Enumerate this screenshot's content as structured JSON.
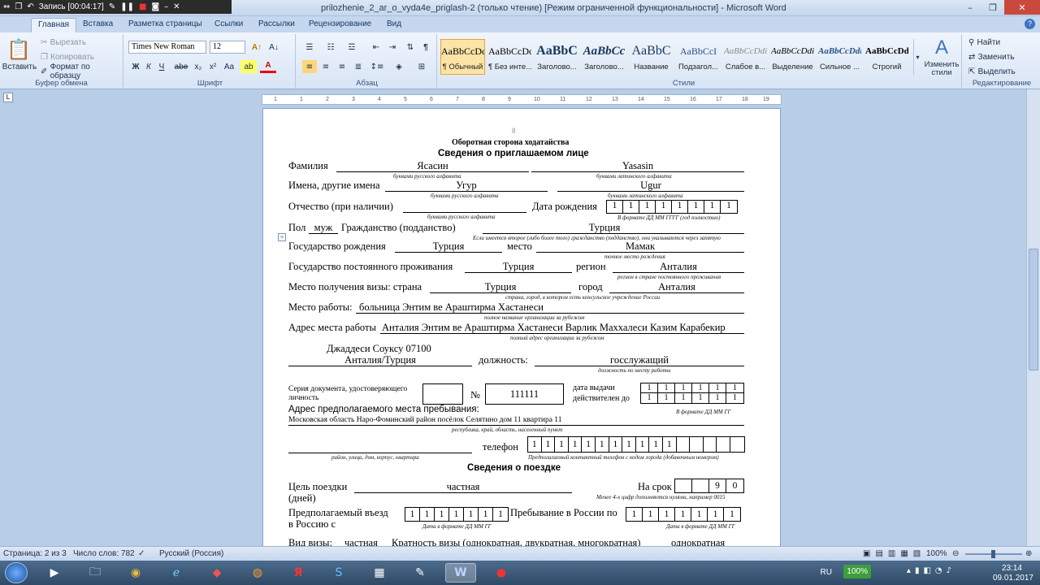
{
  "recorder": {
    "label": "Запись [00:04:17]"
  },
  "window": {
    "title": "prilozhenie_2_ar_o_vyda4e_priglash-2 (только чтение) [Режим ограниченной функциональности] - Microsoft Word"
  },
  "tabs": [
    "Главная",
    "Вставка",
    "Разметка страницы",
    "Ссылки",
    "Рассылки",
    "Рецензирование",
    "Вид"
  ],
  "ribbon": {
    "clipboard": {
      "paste": "Вставить",
      "cut": "Вырезать",
      "copy": "Копировать",
      "format_painter": "Формат по образцу",
      "group": "Буфер обмена"
    },
    "font": {
      "name": "Times New Roman",
      "size": "12",
      "group": "Шрифт"
    },
    "paragraph": {
      "group": "Абзац"
    },
    "styles": {
      "group": "Стили",
      "items": [
        {
          "preview": "AaBbCcDc",
          "name": "¶ Обычный"
        },
        {
          "preview": "AaBbCcDc",
          "name": "¶ Без инте..."
        },
        {
          "preview": "AaBbC",
          "name": "Заголово..."
        },
        {
          "preview": "AaBbCc",
          "name": "Заголово..."
        },
        {
          "preview": "AaBbC",
          "name": "Название"
        },
        {
          "preview": "AaBbCcI",
          "name": "Подзагол..."
        },
        {
          "preview": "AaBbCcDdi",
          "name": "Слабое в..."
        },
        {
          "preview": "AaBbCcDdi",
          "name": "Выделение"
        },
        {
          "preview": "AaBbCcDdi",
          "name": "Сильное ..."
        },
        {
          "preview": "AaBbCcDdE",
          "name": "Строгий"
        }
      ],
      "change": "Изменить стили"
    },
    "editing": {
      "find": "Найти",
      "replace": "Заменить",
      "select": "Выделить",
      "group": "Редактирование"
    }
  },
  "doc": {
    "page_num": "8",
    "title1": "Оборотная сторона ходатайства",
    "title2": "Сведения о приглашаемом лице",
    "surname_label": "Фамилия",
    "surname_ru": "Ясасин",
    "surname_lat": "Yasasin",
    "hint_ru": "буквами русского алфавита",
    "hint_lat": "буквами латинского алфавита",
    "names_label": "Имена, другие имена",
    "names_ru": "Угур",
    "names_lat": "Ugur",
    "patronymic_label": "Отчество (при наличии)",
    "dob_label": "Дата рождения",
    "dob_digits": [
      "1",
      "1",
      "1",
      "1",
      "1",
      "1",
      "1",
      "1"
    ],
    "dob_hint": "В формате ДД ММ ГГГГ (год полностью)",
    "sex_label": "Пол",
    "sex_value": "муж",
    "citizenship_label": "Гражданство (подданство)",
    "citizenship_value": "Турция",
    "citizenship_hint": "Если имеется второе (либо более того) гражданство (подданство), они указываются через запятую",
    "birth_country_label": "Государство рождения",
    "birth_country_value": "Турция",
    "birth_place_label": "место",
    "birth_place_value": "Мамак",
    "birth_place_hint": "точное место рождения",
    "residence_label": "Государство постоянного проживания",
    "residence_value": "Турция",
    "region_label": "регион",
    "region_value": "Анталия",
    "region_hint": "регион в стране постоянного проживания",
    "visa_place_label": "Место получения визы: страна",
    "visa_country": "Турция",
    "city_label": "город",
    "visa_city": "Анталия",
    "visa_hint": "страна, город, в котором есть консульское учреждение России",
    "work_label": "Место работы:",
    "work_value": "больница Энтим ве Араштирма Хастанеси",
    "work_hint": "полное название организации за рубежом",
    "work_addr_label": "Адрес места работы",
    "work_addr_value": "Анталия Энтим ве Араштирма Хастанеси Варлик Маххалеси Казим Карабекир",
    "work_addr_hint": "полный адрес организации за рубежом",
    "work_addr_line2": "Джаддеси Соуксу 07100",
    "work_addr_line3": "Анталия/Турция",
    "position_label": "должность:",
    "position_value": "госслужащий",
    "position_hint": "должность по месту работы",
    "id_doc_label1": "Серия документа, удостоверяющего",
    "id_doc_label2": "личность",
    "no_sign": "№",
    "id_number": "111111",
    "issue_label": "дата выдачи",
    "valid_label": "действителен до",
    "issue_digits": [
      "1",
      "1",
      "1",
      "1",
      "1",
      "1"
    ],
    "valid_digits": [
      "1",
      "1",
      "1",
      "1",
      "1",
      "1"
    ],
    "date_hint": "В формате ДД ММ ГГ",
    "stay_addr_label": "Адрес предполагаемого места пребывания:",
    "stay_addr_value": "Московская область Наро-Фоминский район посёлок Селятино дом 11 квартира 11",
    "stay_addr_hint1": "республика, край, область, населенный пункт",
    "stay_addr_hint2": "район, улица, дом, корпус, квартира",
    "phone_label": "телефон",
    "phone_digits": [
      "1",
      "1",
      "1",
      "1",
      "1",
      "1",
      "1",
      "1",
      "1",
      "1",
      "1",
      "",
      "",
      "",
      "",
      ""
    ],
    "phone_hint": "Предполагаемый контактный телефон с кодом города (добавочным номером)",
    "trip_title": "Сведения о поездке",
    "purpose_label": "Цель поездки",
    "purpose_value": "частная",
    "days_label": "(дней)",
    "term_label": "На срок",
    "term_digits": [
      "",
      "",
      "9",
      "0"
    ],
    "term_hint": "Менее 4-х цифр дополняются нулями, например 0015",
    "entry_label1": "Предполагаемый въезд",
    "entry_label2": "в Россию с",
    "entry_digits": [
      "1",
      "1",
      "1",
      "1",
      "1",
      "1",
      "1"
    ],
    "entry_hint": "Дата в формате ДД ММ ГГ",
    "stay_label": "Пребывание в России по",
    "stay_digits": [
      "1",
      "1",
      "1",
      "1",
      "1",
      "1",
      "1"
    ],
    "stay_hint": "Дата в формате ДД ММ ГГ",
    "visa_kind_label": "Вид визы:",
    "visa_kind_value": "частная",
    "multiplicity_label": "Кратность визы (однократная, двукратная, многократная)",
    "multiplicity_value": "однократная"
  },
  "status": {
    "page": "Страница: 2 из 3",
    "words": "Число слов: 782",
    "lang": "Русский (Россия)",
    "zoom": "100%"
  },
  "tray": {
    "lang": "RU",
    "battery": "100%",
    "time": "23:14",
    "date": "09.01.2017"
  }
}
